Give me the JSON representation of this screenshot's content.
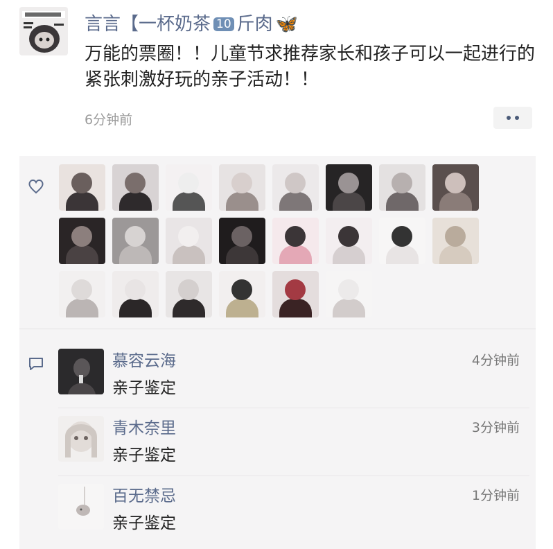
{
  "post": {
    "poster_name_part1": "言言【一杯奶茶",
    "poster_name_badge": "10",
    "poster_name_part2": "斤肉",
    "poster_name_emoji": "🦋",
    "content": "万能的票圈！！儿童节求推荐家长和孩子可以一起进行的紧张刺激好玩的亲子活动！！",
    "time": "6分钟前",
    "more_icon": "more-dots-icon"
  },
  "likes": {
    "icon": "heart-icon",
    "count_avatars": 22
  },
  "comments": [
    {
      "name": "慕容云海",
      "text": "亲子鉴定",
      "time": "4分钟前"
    },
    {
      "name": "青木奈里",
      "text": "亲子鉴定",
      "time": "3分钟前"
    },
    {
      "name": "百无禁忌",
      "text": "亲子鉴定",
      "time": "1分钟前"
    }
  ],
  "comment_icon": "comment-bubble-icon"
}
